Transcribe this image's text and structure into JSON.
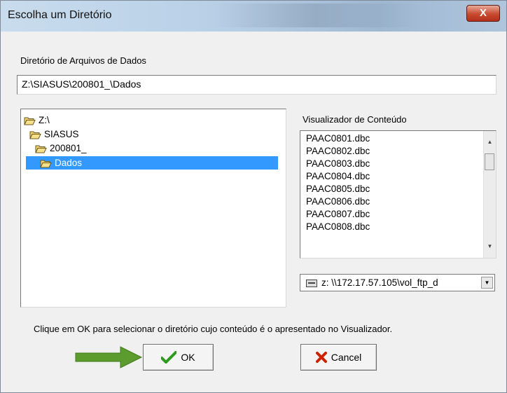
{
  "window": {
    "title": "Escolha um Diretório",
    "close_glyph": "X"
  },
  "directory": {
    "label": "Diretório de Arquivos de Dados",
    "value": "Z:\\SIASUS\\200801_\\Dados"
  },
  "tree": {
    "items": [
      {
        "label": "Z:\\",
        "selected": false
      },
      {
        "label": "SIASUS",
        "selected": false
      },
      {
        "label": "200801_",
        "selected": false
      },
      {
        "label": "Dados",
        "selected": true
      }
    ]
  },
  "viewer": {
    "label": "Visualizador de Conteúdo",
    "files": [
      "PAAC0801.dbc",
      "PAAC0802.dbc",
      "PAAC0803.dbc",
      "PAAC0804.dbc",
      "PAAC0805.dbc",
      "PAAC0806.dbc",
      "PAAC0807.dbc",
      "PAAC0808.dbc"
    ]
  },
  "drive": {
    "value": "z: \\\\172.17.57.105\\vol_ftp_d"
  },
  "instruction": "Clique em OK para selecionar o diretório cujo conteúdo é o apresentado no Visualizador.",
  "buttons": {
    "ok": "OK",
    "cancel": "Cancel"
  },
  "colors": {
    "selection": "#3399ff",
    "arrow": "#5c9b2e",
    "ok_check": "#2c9a1c",
    "cancel_x": "#cc2200",
    "close": "#c84a30",
    "folder": "#f2d36c"
  }
}
